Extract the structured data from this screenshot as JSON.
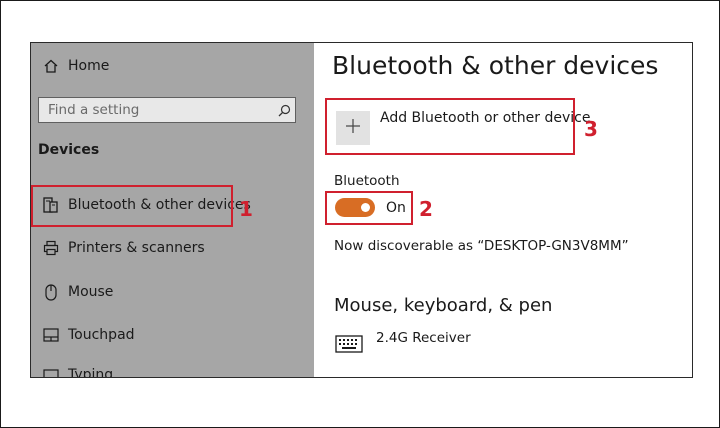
{
  "sidebar": {
    "home_label": "Home",
    "search_placeholder": "Find a setting",
    "section_header": "Devices",
    "items": [
      {
        "label": "Bluetooth & other devices",
        "icon": "bluetooth-device-icon"
      },
      {
        "label": "Printers & scanners",
        "icon": "printer-icon"
      },
      {
        "label": "Mouse",
        "icon": "mouse-icon"
      },
      {
        "label": "Touchpad",
        "icon": "touchpad-icon"
      },
      {
        "label": "Typing",
        "icon": "keyboard-icon"
      }
    ]
  },
  "main": {
    "title": "Bluetooth & other devices",
    "add_device_label": "Add Bluetooth or other device",
    "bluetooth_label": "Bluetooth",
    "toggle_state": "On",
    "discoverable_text": "Now discoverable as “DESKTOP-GN3V8MM”",
    "section_title": "Mouse, keyboard, & pen",
    "devices": [
      {
        "name": "2.4G Receiver",
        "icon": "keyboard-icon"
      }
    ]
  },
  "annotations": [
    "1",
    "2",
    "3"
  ],
  "colors": {
    "sidebar_bg": "#a6a6a6",
    "accent_toggle": "#d86d24",
    "annotation_red": "#d0202e"
  }
}
